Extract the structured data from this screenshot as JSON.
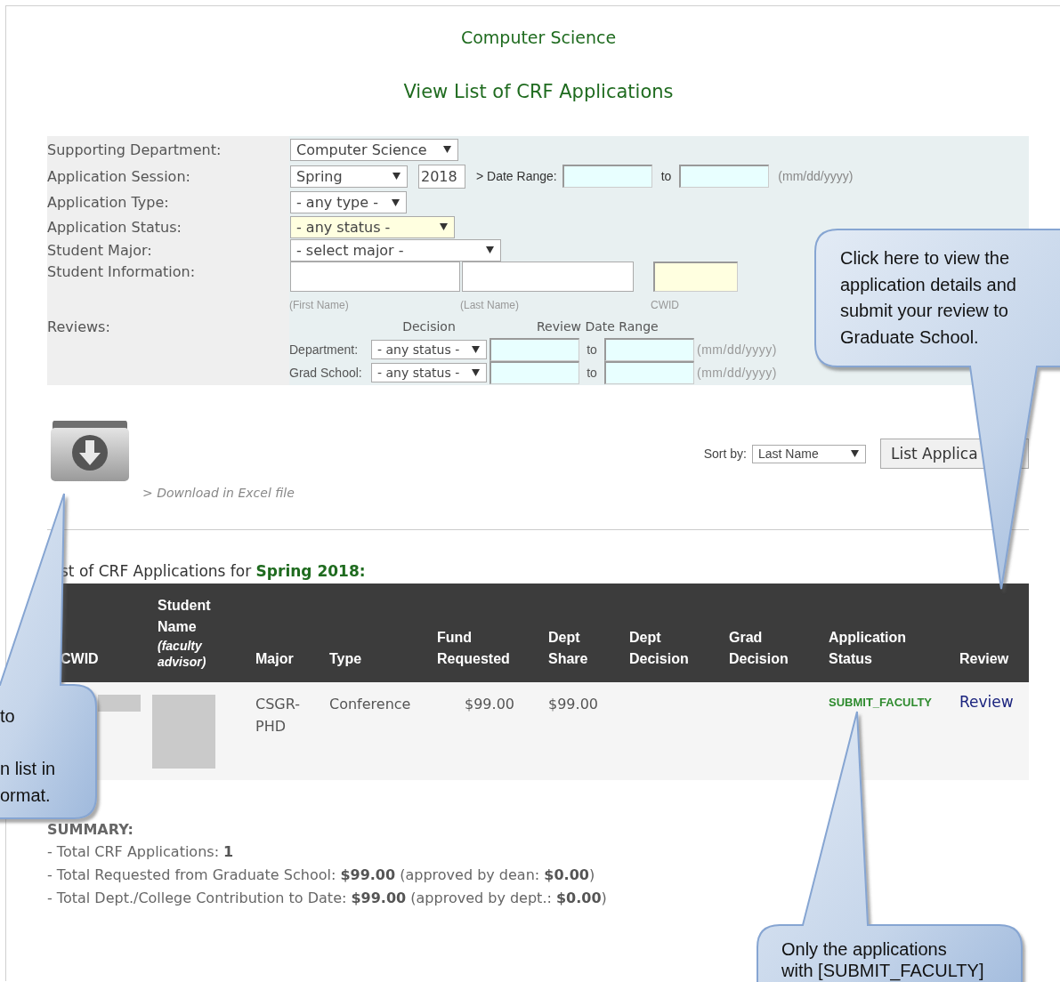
{
  "header": {
    "department": "Computer Science",
    "title": "View List of CRF Applications"
  },
  "filters": {
    "supporting_department": {
      "label": "Supporting Department:",
      "value": "Computer Science"
    },
    "application_session": {
      "label": "Application Session:",
      "session": "Spring",
      "year": "2018",
      "date_range_label": "> Date Range:",
      "to": "to",
      "format_hint": "(mm/dd/yyyy)"
    },
    "application_type": {
      "label": "Application Type:",
      "value": "- any type -"
    },
    "application_status": {
      "label": "Application Status:",
      "value": "- any status -"
    },
    "student_major": {
      "label": "Student Major:",
      "value": "- select major -"
    },
    "student_information": {
      "label": "Student Information:",
      "first_name_hint": "(First Name)",
      "last_name_hint": "(Last Name)",
      "cwid_hint": "CWID"
    },
    "reviews": {
      "label": "Reviews:",
      "decision_header": "Decision",
      "date_range_header": "Review Date Range",
      "rows": [
        {
          "label": "Department:",
          "value": "- any status -",
          "to": "to",
          "format_hint": "(mm/dd/yyyy)"
        },
        {
          "label": "Grad School:",
          "value": "- any status -",
          "to": "to",
          "format_hint": "(mm/dd/yyyy)"
        }
      ]
    }
  },
  "download": {
    "label": "> Download in Excel file"
  },
  "sort": {
    "label": "Sort by:",
    "value": "Last Name",
    "button": "List Applica"
  },
  "list_heading": "st of CRF Applications for **Spring 2018:**",
  "table": {
    "columns": [
      {
        "label": "CWID"
      },
      {
        "label": "Student Name",
        "sub": "(faculty advisor)"
      },
      {
        "label": "Major"
      },
      {
        "label": "Type"
      },
      {
        "label": "Fund Requested"
      },
      {
        "label": "Dept Share"
      },
      {
        "label": "Dept Decision"
      },
      {
        "label": "Grad Decision"
      },
      {
        "label": "Application Status"
      },
      {
        "label": "Review"
      }
    ],
    "rows": [
      {
        "cells": [
          {
            "kind": "redacted"
          },
          {
            "kind": "redacted"
          },
          {
            "kind": "text",
            "text": "CSGR-PHD"
          },
          {
            "kind": "text",
            "text": "Conference"
          },
          {
            "kind": "money",
            "text": "$99.00"
          },
          {
            "kind": "text",
            "text": "$99.00"
          },
          {
            "kind": "empty"
          },
          {
            "kind": "empty"
          },
          {
            "kind": "status",
            "text": "SUBMIT_FACULTY"
          },
          {
            "kind": "link",
            "text": "Review"
          }
        ]
      }
    ]
  },
  "summary": {
    "title": "SUMMARY:",
    "lines": [
      "- Total CRF Applications: **1**",
      "- Total Requested from Graduate School: **$99.00** (approved by dean: **$0.00**)",
      "- Total Dept./College Contribution to Date: **$99.00** (approved by dept.: **$0.00**)"
    ]
  },
  "callouts": [
    {
      "lines": [
        "Click here to view the",
        "application details and",
        "submit your review to",
        "Graduate School."
      ]
    },
    {
      "lines": [
        "to",
        "n list in",
        "ormat."
      ]
    },
    {
      "lines": [
        "Only the applications",
        "with [SUBMIT_FACULTY]"
      ]
    }
  ]
}
